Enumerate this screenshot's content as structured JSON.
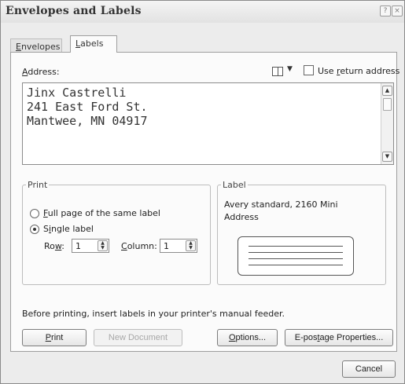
{
  "window": {
    "title": "Envelopes and Labels",
    "help_symbol": "?",
    "close_symbol": "×"
  },
  "tabs": [
    {
      "label_u": "E",
      "label_rest": "nvelopes"
    },
    {
      "label_u": "L",
      "label_rest": "abels"
    }
  ],
  "address": {
    "label_u": "A",
    "label_rest": "ddress:",
    "book_dropdown_arrow": "▼",
    "use_return_u": "r",
    "use_return_pre": "Use ",
    "use_return_post": "eturn address",
    "lines": [
      "Jinx Castrelli",
      "241 East Ford St.",
      "Mantwee, MN 04917"
    ]
  },
  "print_group": {
    "title": "Print",
    "full_page_u": "F",
    "full_page_rest": "ull page of the same label",
    "single_u": "i",
    "single_pre": "S",
    "single_rest": "ngle label",
    "selected": "single",
    "row_u": "w",
    "row_pre": "Ro",
    "row_rest": ":",
    "row_value": "1",
    "column_u": "C",
    "column_rest": "olumn:",
    "column_value": "1"
  },
  "label_group": {
    "title": "Label",
    "line1": "Avery standard, 2160 Mini",
    "line2": "Address"
  },
  "notice": "Before printing, insert labels in your printer's manual feeder.",
  "buttons": {
    "print_u": "P",
    "print_rest": "rint",
    "new_document": "New Document",
    "options_u": "O",
    "options_rest": "ptions...",
    "epostage_pre": "E-pos",
    "epostage_u": "t",
    "epostage_rest": "age Properties...",
    "cancel": "Cancel"
  }
}
